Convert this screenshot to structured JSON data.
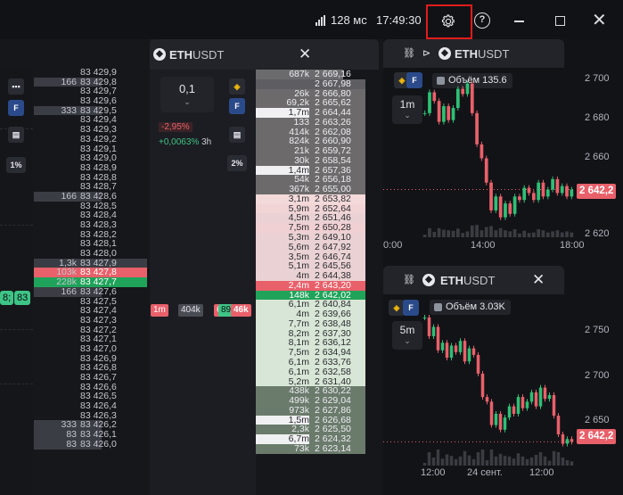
{
  "topbar": {
    "ping": "128 мс",
    "clock": "17:49:30",
    "icons": [
      "signal-icon",
      "gear-icon",
      "help-icon",
      "minimize-icon",
      "maximize-icon",
      "close-icon"
    ]
  },
  "left_book": {
    "tools": [
      "hidden-icon",
      "F",
      "list-icon",
      "1%"
    ],
    "rows": [
      {
        "v": "",
        "p": "83 429,9"
      },
      {
        "v": "166",
        "p": "83 429,8",
        "hl": true
      },
      {
        "v": "",
        "p": "83 429,7"
      },
      {
        "v": "",
        "p": "83 429,6"
      },
      {
        "v": "333",
        "p": "83 429,5",
        "hl": true
      },
      {
        "v": "",
        "p": "83 429,4"
      },
      {
        "v": "",
        "p": "83 429,3"
      },
      {
        "v": "",
        "p": "83 429,2"
      },
      {
        "v": "",
        "p": "83 429,1"
      },
      {
        "v": "",
        "p": "83 429,0"
      },
      {
        "v": "",
        "p": "83 428,9"
      },
      {
        "v": "",
        "p": "83 428,8"
      },
      {
        "v": "",
        "p": "83 428,7"
      },
      {
        "v": "166",
        "p": "83 428,6",
        "hl": true
      },
      {
        "v": "",
        "p": "83 428,5"
      },
      {
        "v": "",
        "p": "83 428,4"
      },
      {
        "v": "",
        "p": "83 428,3"
      },
      {
        "v": "",
        "p": "83 428,2"
      },
      {
        "v": "",
        "p": "83 428,1"
      },
      {
        "v": "",
        "p": "83 428,0"
      },
      {
        "v": "1,3k",
        "p": "83 427,9",
        "hl": true
      },
      {
        "v": "103k",
        "p": "83 427,8",
        "t": "ask"
      },
      {
        "v": "228k",
        "p": "83 427,7",
        "t": "bid"
      },
      {
        "v": "166",
        "p": "83 427,6",
        "hl": true
      },
      {
        "v": "",
        "p": "83 427,5"
      },
      {
        "v": "",
        "p": "83 427,4"
      },
      {
        "v": "",
        "p": "83 427,3"
      },
      {
        "v": "",
        "p": "83 427,2"
      },
      {
        "v": "",
        "p": "83 427,1"
      },
      {
        "v": "",
        "p": "83 427,0"
      },
      {
        "v": "",
        "p": "83 426,9"
      },
      {
        "v": "",
        "p": "83 426,8"
      },
      {
        "v": "",
        "p": "83 426,7"
      },
      {
        "v": "",
        "p": "83 426,6"
      },
      {
        "v": "",
        "p": "83 426,5"
      },
      {
        "v": "",
        "p": "83 426,4"
      },
      {
        "v": "",
        "p": "83 426,3"
      },
      {
        "v": "333",
        "p": "83 426,2",
        "hl": true
      },
      {
        "v": "83",
        "p": "83 426,1",
        "hl": true
      },
      {
        "v": "83",
        "p": "83 426,0",
        "hl": true
      }
    ],
    "tags": [
      "8;",
      "83"
    ]
  },
  "center": {
    "title_bold": "ETH",
    "title_rest": "USDT",
    "tick": "0,1",
    "change_pct": "-2,95%",
    "funding": "+0,0063%",
    "funding_period": "3h",
    "tools": [
      "binance-icon",
      "F",
      "list-icon",
      "2%"
    ],
    "vol_tags": [
      "1m",
      "404k",
      "6",
      "89",
      "46k"
    ],
    "rows": [
      {
        "v": "687k",
        "p": "2 669,16",
        "b": 0.8,
        "c": "#6b6b6e"
      },
      {
        "v": "",
        "p": "2 667,98",
        "b": 1.0,
        "c": "#5e5e62"
      },
      {
        "v": "26k",
        "p": "2 666,80",
        "b": 1.0,
        "c": "#6c6a6b"
      },
      {
        "v": "69,2k",
        "p": "2 665,62",
        "b": 1.0,
        "c": "#6c6a6b"
      },
      {
        "v": "1,7m",
        "p": "2 664,44",
        "b": 1.0,
        "c": "#6c6a6b",
        "w": true
      },
      {
        "v": "133",
        "p": "2 663,26",
        "b": 1.0,
        "c": "#6c6a6b"
      },
      {
        "v": "414k",
        "p": "2 662,08",
        "b": 1.0,
        "c": "#6c6a6b"
      },
      {
        "v": "824k",
        "p": "2 660,90",
        "b": 1.0,
        "c": "#6c6a6b"
      },
      {
        "v": "21k",
        "p": "2 659,72",
        "b": 1.0,
        "c": "#6c6a6b"
      },
      {
        "v": "30k",
        "p": "2 658,54",
        "b": 1.0,
        "c": "#6c6a6b"
      },
      {
        "v": "1,4m",
        "p": "2 657,36",
        "b": 1.0,
        "c": "#6c6a6b",
        "w": true
      },
      {
        "v": "54k",
        "p": "2 656,18",
        "b": 1.0,
        "c": "#6c6a6b"
      },
      {
        "v": "367k",
        "p": "2 655,00",
        "b": 1.0,
        "c": "#6c6a6b"
      },
      {
        "v": "3,1m",
        "p": "2 653,82",
        "b": 1.0,
        "c": "#f3d9da"
      },
      {
        "v": "5,9m",
        "p": "2 652,64",
        "b": 1.0,
        "c": "#f0d4d6"
      },
      {
        "v": "4,5m",
        "p": "2 651,46",
        "b": 1.0,
        "c": "#ead2d4"
      },
      {
        "v": "7,5m",
        "p": "2 650,28",
        "b": 1.0,
        "c": "#f0d0d3"
      },
      {
        "v": "5,3m",
        "p": "2 649,10",
        "b": 1.0,
        "c": "#ead2d4"
      },
      {
        "v": "5,6m",
        "p": "2 647,92",
        "b": 1.0,
        "c": "#ead2d4"
      },
      {
        "v": "3,5m",
        "p": "2 646,74",
        "b": 1.0,
        "c": "#ead2d4"
      },
      {
        "v": "5,1m",
        "p": "2 645,56",
        "b": 1.0,
        "c": "#ead2d4"
      },
      {
        "v": "4m",
        "p": "2 644,38",
        "b": 1.0,
        "c": "#ead2d4"
      },
      {
        "v": "2,4m",
        "p": "2 643,20",
        "b": 1.0,
        "c": "#e8606a",
        "ask": true
      },
      {
        "v": "148k",
        "p": "2 642,02",
        "b": 1.0,
        "c": "#1fa35a",
        "bid": true
      },
      {
        "v": "6,1m",
        "p": "2 640,84",
        "b": 1.0,
        "c": "#d7e6d6"
      },
      {
        "v": "4m",
        "p": "2 639,66",
        "b": 1.0,
        "c": "#d7e6d6"
      },
      {
        "v": "7,7m",
        "p": "2 638,48",
        "b": 1.0,
        "c": "#d7e6d6"
      },
      {
        "v": "8,2m",
        "p": "2 637,30",
        "b": 1.0,
        "c": "#d7e6d6"
      },
      {
        "v": "8,1m",
        "p": "2 636,12",
        "b": 1.0,
        "c": "#d7e6d6"
      },
      {
        "v": "7,5m",
        "p": "2 634,94",
        "b": 1.0,
        "c": "#d7e6d6"
      },
      {
        "v": "6,1m",
        "p": "2 633,76",
        "b": 1.0,
        "c": "#d7e6d6"
      },
      {
        "v": "6,1m",
        "p": "2 632,58",
        "b": 1.0,
        "c": "#d7e6d6"
      },
      {
        "v": "5,2m",
        "p": "2 631,40",
        "b": 1.0,
        "c": "#d7e6d6"
      },
      {
        "v": "438k",
        "p": "2 630,22",
        "b": 1.0,
        "c": "#6a7a6b"
      },
      {
        "v": "499k",
        "p": "2 629,04",
        "b": 1.0,
        "c": "#6a7a6b"
      },
      {
        "v": "973k",
        "p": "2 627,86",
        "b": 1.0,
        "c": "#6a7a6b"
      },
      {
        "v": "1,5m",
        "p": "2 626,68",
        "b": 1.0,
        "c": "#6a7a6b",
        "w": true
      },
      {
        "v": "2,3k",
        "p": "2 625,50",
        "b": 1.0,
        "c": "#6a7a6b"
      },
      {
        "v": "6,7m",
        "p": "2 624,32",
        "b": 1.0,
        "c": "#6a7a6b",
        "w": true
      },
      {
        "v": "73k",
        "p": "2 623,14",
        "b": 1.0,
        "c": "#6a7a6b"
      }
    ]
  },
  "chart1": {
    "title_bold": "ETH",
    "title_rest": "USDT",
    "volume_label": "Объём",
    "volume_value": "135.6",
    "timeframe": "1m",
    "last_price": "2 642,2",
    "y_ticks": [
      "2 700",
      "2 680",
      "2 660",
      "2 640",
      "2 620"
    ],
    "x_ticks": [
      "0:00",
      "14:00",
      "18:00"
    ]
  },
  "chart2": {
    "title_bold": "ETH",
    "title_rest": "USDT",
    "volume_label": "Объём",
    "volume_value": "3.03K",
    "timeframe": "5m",
    "last_price": "2 642,2",
    "y_ticks": [
      "2 750",
      "2 700",
      "2 650"
    ],
    "x_ticks": [
      "12:00",
      "24 сент.",
      "12:00"
    ]
  },
  "chart_data": [
    {
      "type": "line",
      "title": "",
      "xlabel": "",
      "ylabel": "",
      "categories": [
        "0:00",
        "14:00",
        "18:00"
      ],
      "ylim": [
        2615,
        2710
      ],
      "series": [
        {
          "values": [
            2688,
            2700,
            2695,
            2683,
            2692,
            2684,
            2691,
            2702,
            2699,
            2705,
            2688,
            2670,
            2662,
            2648,
            2632,
            2640,
            2628,
            2636,
            2630,
            2640,
            2638,
            2645,
            2642,
            2638,
            2648,
            2640,
            2644,
            2650,
            2642,
            2646,
            2640,
            2644
          ]
        }
      ]
    },
    {
      "type": "line",
      "title": "",
      "xlabel": "",
      "ylabel": "",
      "categories": [
        "12:00",
        "24 сент.",
        "12:00"
      ],
      "ylim": [
        2630,
        2775
      ],
      "series": [
        {
          "values": [
            2775,
            2755,
            2765,
            2740,
            2748,
            2732,
            2745,
            2738,
            2750,
            2728,
            2742,
            2735,
            2715,
            2690,
            2685,
            2660,
            2672,
            2655,
            2668,
            2680,
            2672,
            2690,
            2678,
            2685,
            2695,
            2680,
            2700,
            2688,
            2692,
            2670,
            2650,
            2640,
            2645,
            2642
          ]
        }
      ]
    }
  ]
}
